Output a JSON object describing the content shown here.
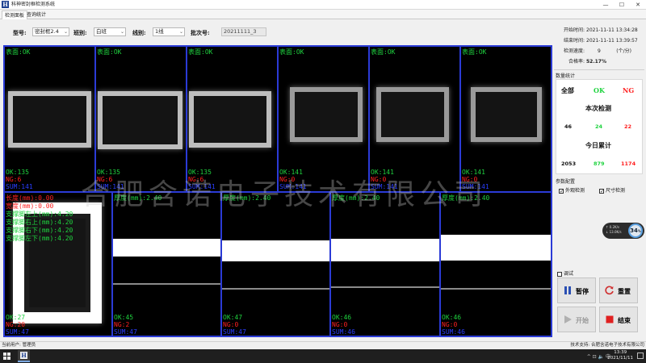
{
  "window": {
    "logo": "H",
    "title": "科神密封框检测系统",
    "min": "—",
    "max": "☐",
    "close": "✕"
  },
  "tabs": [
    {
      "label": "检测面板",
      "active": true
    },
    {
      "label": "查询统计",
      "active": false
    }
  ],
  "toolbar": {
    "model_label": "型号:",
    "model_value": "密封框2.4",
    "shift_label": "班别:",
    "shift_value": "白班",
    "line_label": "线别:",
    "line_value": "1线",
    "batch_label": "批次号:",
    "batch_value": "20211111_3"
  },
  "top_cells": [
    {
      "header": "表面:OK",
      "ok": "OK:135",
      "ng": "NG:6",
      "sum": "SUM:141"
    },
    {
      "header": "表面:OK",
      "ok": "OK:135",
      "ng": "NG:6",
      "sum": "SUM:141"
    },
    {
      "header": "表面:OK",
      "ok": "OK:135",
      "ng": "NG:6",
      "sum": "SUM:141"
    },
    {
      "header": "表面:OK",
      "ok": "OK:141",
      "ng": "NG:0",
      "sum": "SUM:141"
    },
    {
      "header": "表面:OK",
      "ok": "OK:141",
      "ng": "NG:0",
      "sum": "SUM:141"
    },
    {
      "header": "表面:OK",
      "ok": "OK:141",
      "ng": "NG:0",
      "sum": "SUM:141"
    }
  ],
  "first_bottom": {
    "lines": [
      {
        "text": "长度(mm):0.00",
        "color": "red"
      },
      {
        "text": "宽度(mm):0.00",
        "color": "red"
      },
      {
        "text": "支撑脚左上(mm):4.20",
        "color": "green"
      },
      {
        "text": "支撑脚右上(mm):4.20",
        "color": "green"
      },
      {
        "text": "支撑脚右下(mm):4.20",
        "color": "green"
      },
      {
        "text": "支撑脚左下(mm):4.20",
        "color": "green"
      }
    ],
    "ok": "OK:27",
    "ng": "NG:20",
    "sum": "SUM:47"
  },
  "bottom_cells": [
    {
      "header": "厚度(mm):2.40",
      "ok": "OK:45",
      "ng": "NG:2",
      "sum": "SUM:47"
    },
    {
      "header": "厚度(mm):2.40",
      "ok": "OK:47",
      "ng": "NG:0",
      "sum": "SUM:47"
    },
    {
      "header": "厚度(mm):2.40",
      "ok": "OK:46",
      "ng": "NG:0",
      "sum": "SUM:46"
    },
    {
      "header": "厚度(mm):2.40",
      "ok": "OK:46",
      "ng": "NG:0",
      "sum": "SUM:46"
    }
  ],
  "watermark": "合肥含诺电子技术有限公司",
  "info": {
    "start_label": "开始时间:",
    "start_value": "2021-11-11 13:34:28",
    "end_label": "结束时间:",
    "end_value": "2021-11-11 13:39:57",
    "speed_label": "检测速度:",
    "speed_value": "9",
    "speed_unit": "(个/分)",
    "rate_label": "合格率:",
    "rate_value": "52.17%"
  },
  "stats": {
    "section_title": "数量统计",
    "col_all": "全部",
    "col_ok": "OK",
    "col_ng": "NG",
    "current_title": "本次检测",
    "current_all": "46",
    "current_ok": "24",
    "current_ng": "22",
    "today_title": "今日累计",
    "today_all": "2053",
    "today_ok": "879",
    "today_ng": "1174"
  },
  "params": {
    "section_title": "参数配置",
    "appearance": "外观检测",
    "size": "尺寸检测",
    "debug": "调试"
  },
  "controls": {
    "pause": "暂停",
    "reset": "重置",
    "start": "开始",
    "stop": "结束"
  },
  "gauge": {
    "up": "↑ 0.2K/s",
    "down": "↓ 13.0K/s",
    "value": "34",
    "unit": "%"
  },
  "statusbar": {
    "user": "当前用户: 管理员",
    "support": "技术支持: 合肥含诺电子技术有限公司"
  },
  "taskbar": {
    "app_logo": "H",
    "tray": "^ ⊡ 🔈 中",
    "time": "13:39",
    "date": "2021/11/11"
  },
  "colors": {
    "ok": "#1fd33f",
    "ng": "#ff2020",
    "sum": "#2a3dff",
    "grid_border": "#2b3bd6"
  }
}
